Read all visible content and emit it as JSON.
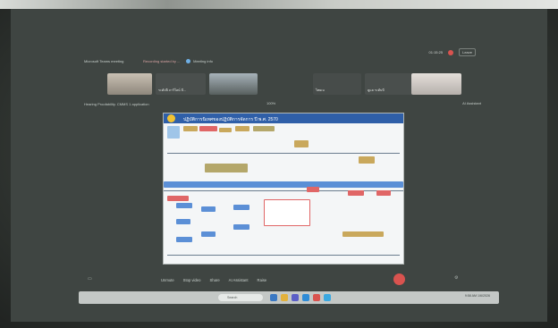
{
  "meeting": {
    "window_title": "Microsoft Teams meeting",
    "recording_note": "Recording started by ...",
    "meeting_info": "Meeting info",
    "time": "01:15:25",
    "leave_label": "Leave"
  },
  "thumbnails": [
    {
      "label": ""
    },
    {
      "label": "ระดับปี ภาวิไลน์ บี..."
    },
    {
      "label": ""
    },
    {
      "label": "ไทยเบ"
    },
    {
      "label": "ดูแล ระดับบี"
    },
    {
      "label": ""
    }
  ],
  "content": {
    "share_title": "Hearing Proofability. CMMS 1 application",
    "zoom": "100%",
    "assistant_label": "AI Assistant"
  },
  "slide": {
    "title": "ปฏิบัติการนิเทศของปฏิบัติการจัดการ ปี พ.ศ. 2570"
  },
  "toolbar": {
    "unmute": "Unmute",
    "stop_video": "Stop video",
    "share": "Share",
    "ai": "AI Assistant",
    "raise": "Raise"
  },
  "taskbar": {
    "search": "Search",
    "tray_time": "9:58 AM",
    "tray_date": "1/6/2026"
  },
  "colors": {
    "accent": "#2f5fa8",
    "danger": "#d9534f"
  }
}
